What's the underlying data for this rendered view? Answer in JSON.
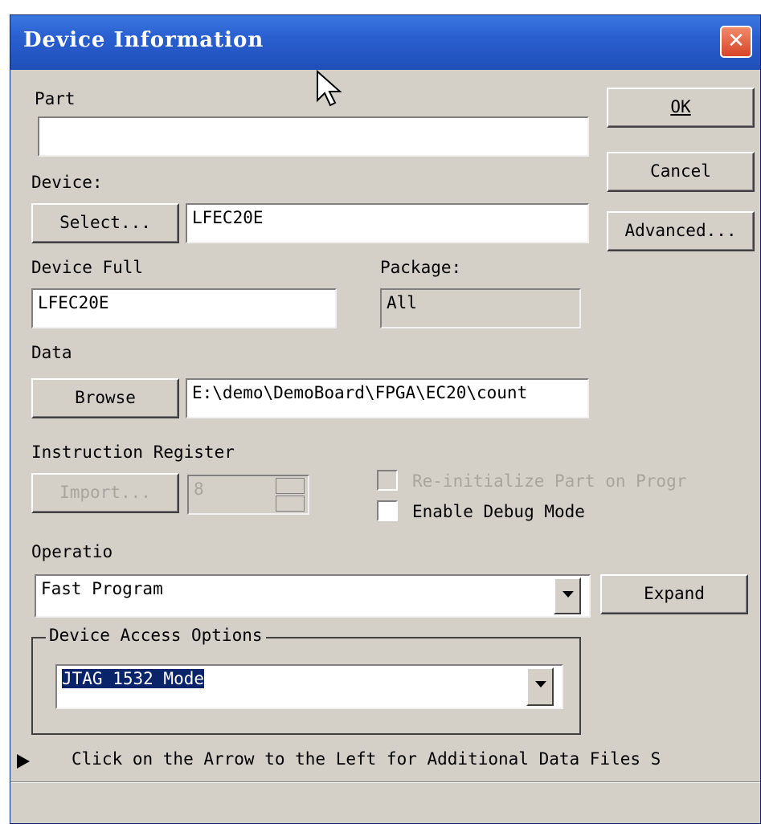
{
  "window": {
    "title": "Device Information",
    "close_glyph": "✕"
  },
  "part": {
    "label": "Part",
    "value": ""
  },
  "device": {
    "label": "Device:",
    "select_button": "Select...",
    "value": "LFEC20E"
  },
  "device_full": {
    "label": "Device Full",
    "value": "LFEC20E"
  },
  "package": {
    "label": "Package:",
    "value": "All"
  },
  "data": {
    "label": "Data",
    "browse_button": "Browse",
    "path": "E:\\demo\\DemoBoard\\FPGA\\EC20\\count"
  },
  "instruction_register": {
    "label": "Instruction Register",
    "import_button": "Import...",
    "spin_value": "8"
  },
  "options": {
    "reinit_label": "Re-initialize Part on Progr",
    "debug_label": "Enable Debug Mode"
  },
  "operation": {
    "label": "Operatio",
    "value": "Fast Program",
    "expand_button": "Expand"
  },
  "access": {
    "group_label": "Device Access Options",
    "value": "JTAG 1532 Mode"
  },
  "footer": {
    "hint": "Click on the Arrow to the Left for Additional Data Files S"
  },
  "buttons": {
    "ok": "OK",
    "cancel": "Cancel",
    "advanced": "Advanced..."
  }
}
